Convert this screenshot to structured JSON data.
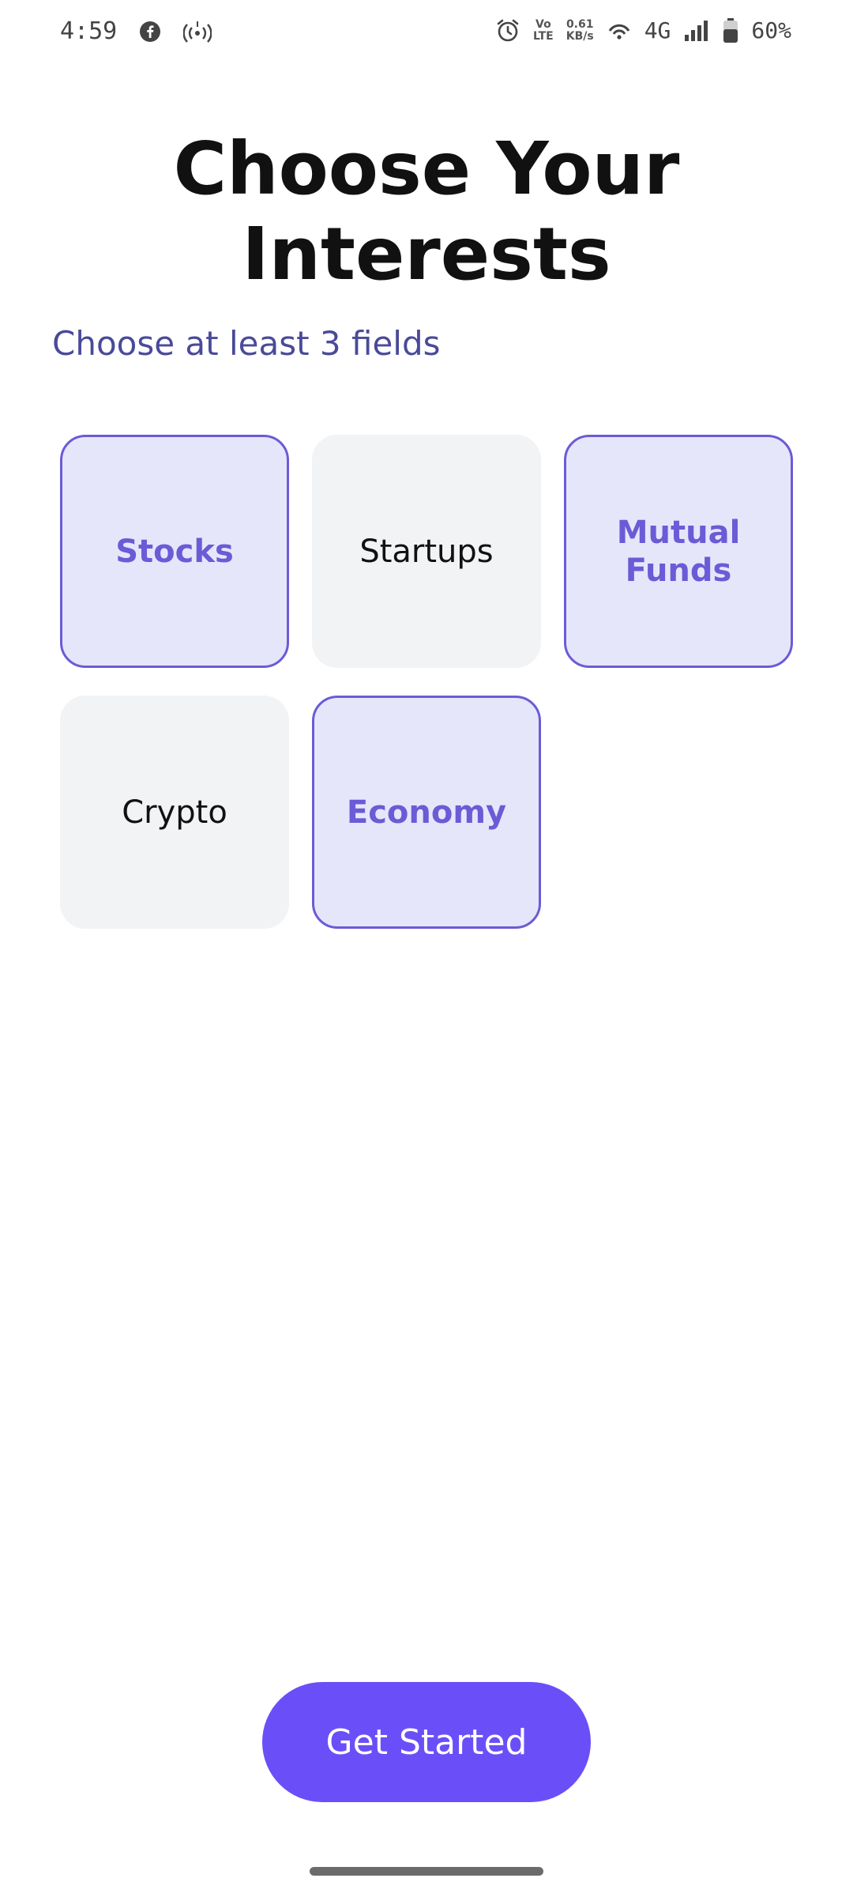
{
  "status_bar": {
    "time": "4:59",
    "volte_top": "Vo",
    "volte_bottom": "LTE",
    "speed_value": "0.61",
    "speed_unit": "KB/s",
    "network": "4G",
    "battery": "60%",
    "icons": [
      "facebook-icon",
      "hotspot-icon",
      "alarm-icon",
      "volte-icon",
      "wifi-icon",
      "signal-icon",
      "battery-icon"
    ]
  },
  "page": {
    "title_line1": "Choose Your",
    "title_line2": "Interests",
    "subtitle": "Choose at least 3 fields"
  },
  "interests": [
    {
      "label": "Stocks",
      "selected": true
    },
    {
      "label": "Startups",
      "selected": false
    },
    {
      "label": "Mutual Funds",
      "selected": true
    },
    {
      "label": "Crypto",
      "selected": false
    },
    {
      "label": "Economy",
      "selected": true
    }
  ],
  "cta": {
    "label": "Get Started"
  },
  "colors": {
    "accent": "#6a4ff8",
    "selected_bg": "#e6e6fa",
    "selected_border": "#6b5bd6",
    "unselected_bg": "#f2f3f5",
    "subtitle": "#4a4a9a"
  }
}
